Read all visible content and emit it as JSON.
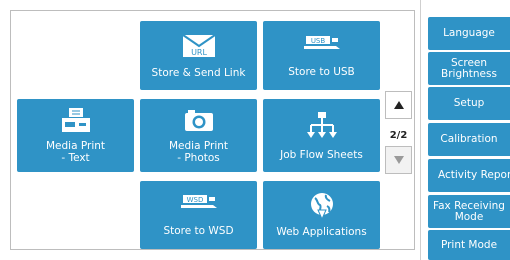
{
  "tiles": {
    "store_send_link": "Store & Send Link",
    "store_usb": "Store to USB",
    "media_print_text": "Media Print\n- Text",
    "media_print_photos": "Media Print\n- Photos",
    "job_flow_sheets": "Job Flow Sheets",
    "store_wsd": "Store to WSD",
    "web_applications": "Web Applications",
    "icon_text_url": "URL",
    "icon_text_usb": "USB",
    "icon_text_wsd": "WSD"
  },
  "pager": {
    "indicator": "2/2"
  },
  "side_menu": {
    "language": "Language",
    "screen_brightness": "Screen\nBrightness",
    "setup": "Setup",
    "calibration": "Calibration",
    "activity_report": "Activity Report",
    "fax_receiving_mode": "Fax Receiving\nMode",
    "print_mode": "Print Mode"
  },
  "colors": {
    "tile": "#2f93c6",
    "border": "#bdbdbd"
  }
}
